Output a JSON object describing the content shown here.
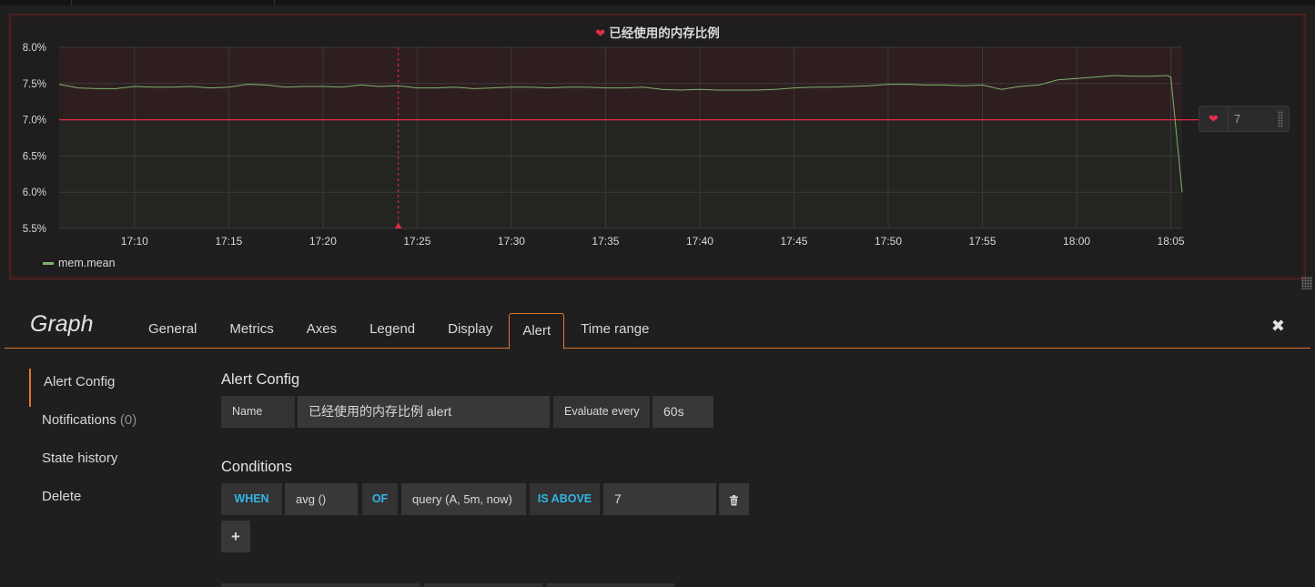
{
  "panel": {
    "title": "已经使用的内存比例",
    "threshold_value": "7",
    "legend": {
      "series_name": "mem.mean",
      "color": "#7eb26d"
    }
  },
  "chart_data": {
    "type": "line",
    "title": "已经使用的内存比例",
    "y_ticks": [
      "8.0%",
      "7.5%",
      "7.0%",
      "6.5%",
      "6.0%",
      "5.5%"
    ],
    "ylim": [
      5.5,
      8.0
    ],
    "x_ticks": [
      "17:10",
      "17:15",
      "17:20",
      "17:25",
      "17:30",
      "17:35",
      "17:40",
      "17:45",
      "17:50",
      "17:55",
      "18:00",
      "18:05"
    ],
    "x_tick_minutes": [
      10,
      15,
      20,
      25,
      30,
      35,
      40,
      45,
      50,
      55,
      60,
      65
    ],
    "xlim_minutes": [
      6,
      65.6
    ],
    "threshold": 7.0,
    "annotation_minute": 24,
    "series": [
      {
        "name": "mem.mean",
        "color": "#7eb26d",
        "x_minutes": [
          6,
          7,
          8,
          9,
          10,
          11,
          12,
          13,
          14,
          15,
          16,
          17,
          18,
          19,
          20,
          21,
          22,
          23,
          24,
          25,
          26,
          27,
          28,
          29,
          30,
          31,
          32,
          33,
          34,
          35,
          36,
          37,
          38,
          39,
          40,
          41,
          42,
          43,
          44,
          45,
          46,
          47,
          48,
          49,
          50,
          51,
          52,
          53,
          54,
          55,
          56,
          57,
          58,
          59,
          60,
          61,
          62,
          63,
          64,
          64.8,
          65,
          65.6
        ],
        "values": [
          7.49,
          7.44,
          7.43,
          7.43,
          7.46,
          7.45,
          7.45,
          7.46,
          7.44,
          7.45,
          7.49,
          7.48,
          7.45,
          7.46,
          7.46,
          7.45,
          7.48,
          7.46,
          7.47,
          7.44,
          7.44,
          7.45,
          7.43,
          7.44,
          7.45,
          7.45,
          7.44,
          7.45,
          7.45,
          7.44,
          7.44,
          7.45,
          7.42,
          7.41,
          7.42,
          7.41,
          7.41,
          7.41,
          7.42,
          7.44,
          7.45,
          7.45,
          7.46,
          7.47,
          7.49,
          7.49,
          7.48,
          7.48,
          7.47,
          7.48,
          7.42,
          7.46,
          7.48,
          7.55,
          7.57,
          7.59,
          7.61,
          7.6,
          7.6,
          7.61,
          7.59,
          6.0
        ]
      }
    ],
    "grid": true,
    "legend": "bottom-left"
  },
  "editor": {
    "title": "Graph",
    "tabs": [
      "General",
      "Metrics",
      "Axes",
      "Legend",
      "Display",
      "Alert",
      "Time range"
    ],
    "active_tab": "Alert",
    "close_label": "✖"
  },
  "sidenav": {
    "alert_config": "Alert Config",
    "notifications": "Notifications",
    "notifications_count": "(0)",
    "state_history": "State history",
    "delete": "Delete"
  },
  "alert_config": {
    "heading": "Alert Config",
    "name_label": "Name",
    "name_value": "已经使用的内存比例 alert",
    "evaluate_label": "Evaluate every",
    "evaluate_value": "60s"
  },
  "conditions": {
    "heading": "Conditions",
    "when": "WHEN",
    "reducer": "avg ()",
    "of": "OF",
    "query": "query (A, 5m, now)",
    "evaluator": "IS ABOVE",
    "threshold": "7",
    "delete_icon": "trash-icon",
    "add_label": "+"
  },
  "colors": {
    "accent": "#e0752d",
    "critical": "#e02f44",
    "keyword": "#33b5e5",
    "series": "#7eb26d"
  }
}
